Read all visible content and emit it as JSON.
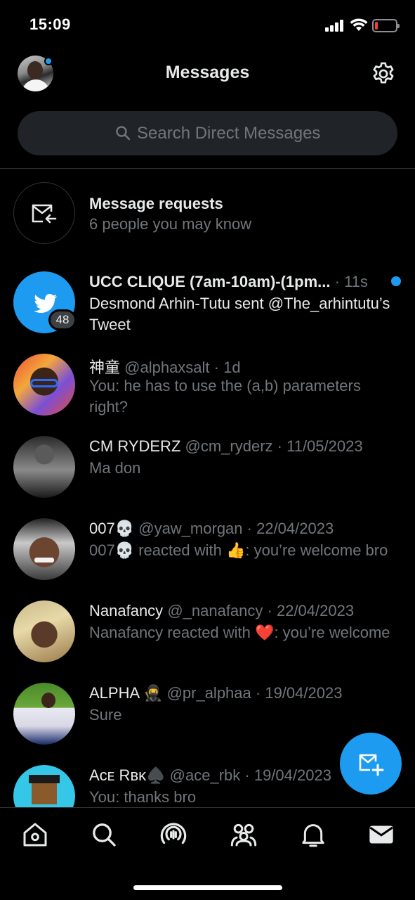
{
  "status_bar": {
    "time": "15:09"
  },
  "header": {
    "title": "Messages"
  },
  "search": {
    "placeholder": "Search Direct Messages"
  },
  "message_requests": {
    "title": "Message requests",
    "subtitle": "6 people you may know"
  },
  "conversations": [
    {
      "name": "UCC CLIQUE (7am-10am)-(1pm...",
      "handle": "",
      "time": "· 11s",
      "preview": "Desmond Arhin-Tutu sent @The_arhintutu’s Tweet",
      "badge": "48",
      "unread": true
    },
    {
      "name": "神童",
      "handle": "@alphaxsalt",
      "time": "· 1d",
      "preview": "You: he has to use the (a,b) parameters right?"
    },
    {
      "name": "CM RYDERZ",
      "handle": "@cm_ryderz",
      "time": "· 11/05/2023",
      "preview": "Ma don"
    },
    {
      "name": "007💀",
      "handle": "@yaw_morgan",
      "time": "· 22/04/2023",
      "preview_before": "007💀 reacted with ",
      "preview_emoji": "👍",
      "preview_after": ": you’re welcome bro"
    },
    {
      "name": "Nanafancy",
      "handle": "@_nanafancy",
      "time": "· 22/04/2023",
      "preview_before": "Nanafancy reacted with ",
      "preview_emoji": "❤️",
      "preview_after": ": you’re welcome"
    },
    {
      "name": "ALPHA 🥷",
      "handle": "@pr_alphaa",
      "time": "· 19/04/2023",
      "preview": "Sure"
    },
    {
      "name": "Aᴄᴇ Rʙᴋ♠️",
      "handle": "@ace_rbk",
      "time": "· 19/04/2023",
      "preview": "You: thanks bro"
    }
  ],
  "icons": {
    "settings": "gear-icon",
    "new_message": "compose-message-icon",
    "tabs": [
      "home-icon",
      "search-icon",
      "spaces-icon",
      "communities-icon",
      "notifications-icon",
      "messages-icon"
    ]
  },
  "colors": {
    "accent": "#1d9bf0",
    "background": "#000000",
    "muted": "#71767b"
  }
}
